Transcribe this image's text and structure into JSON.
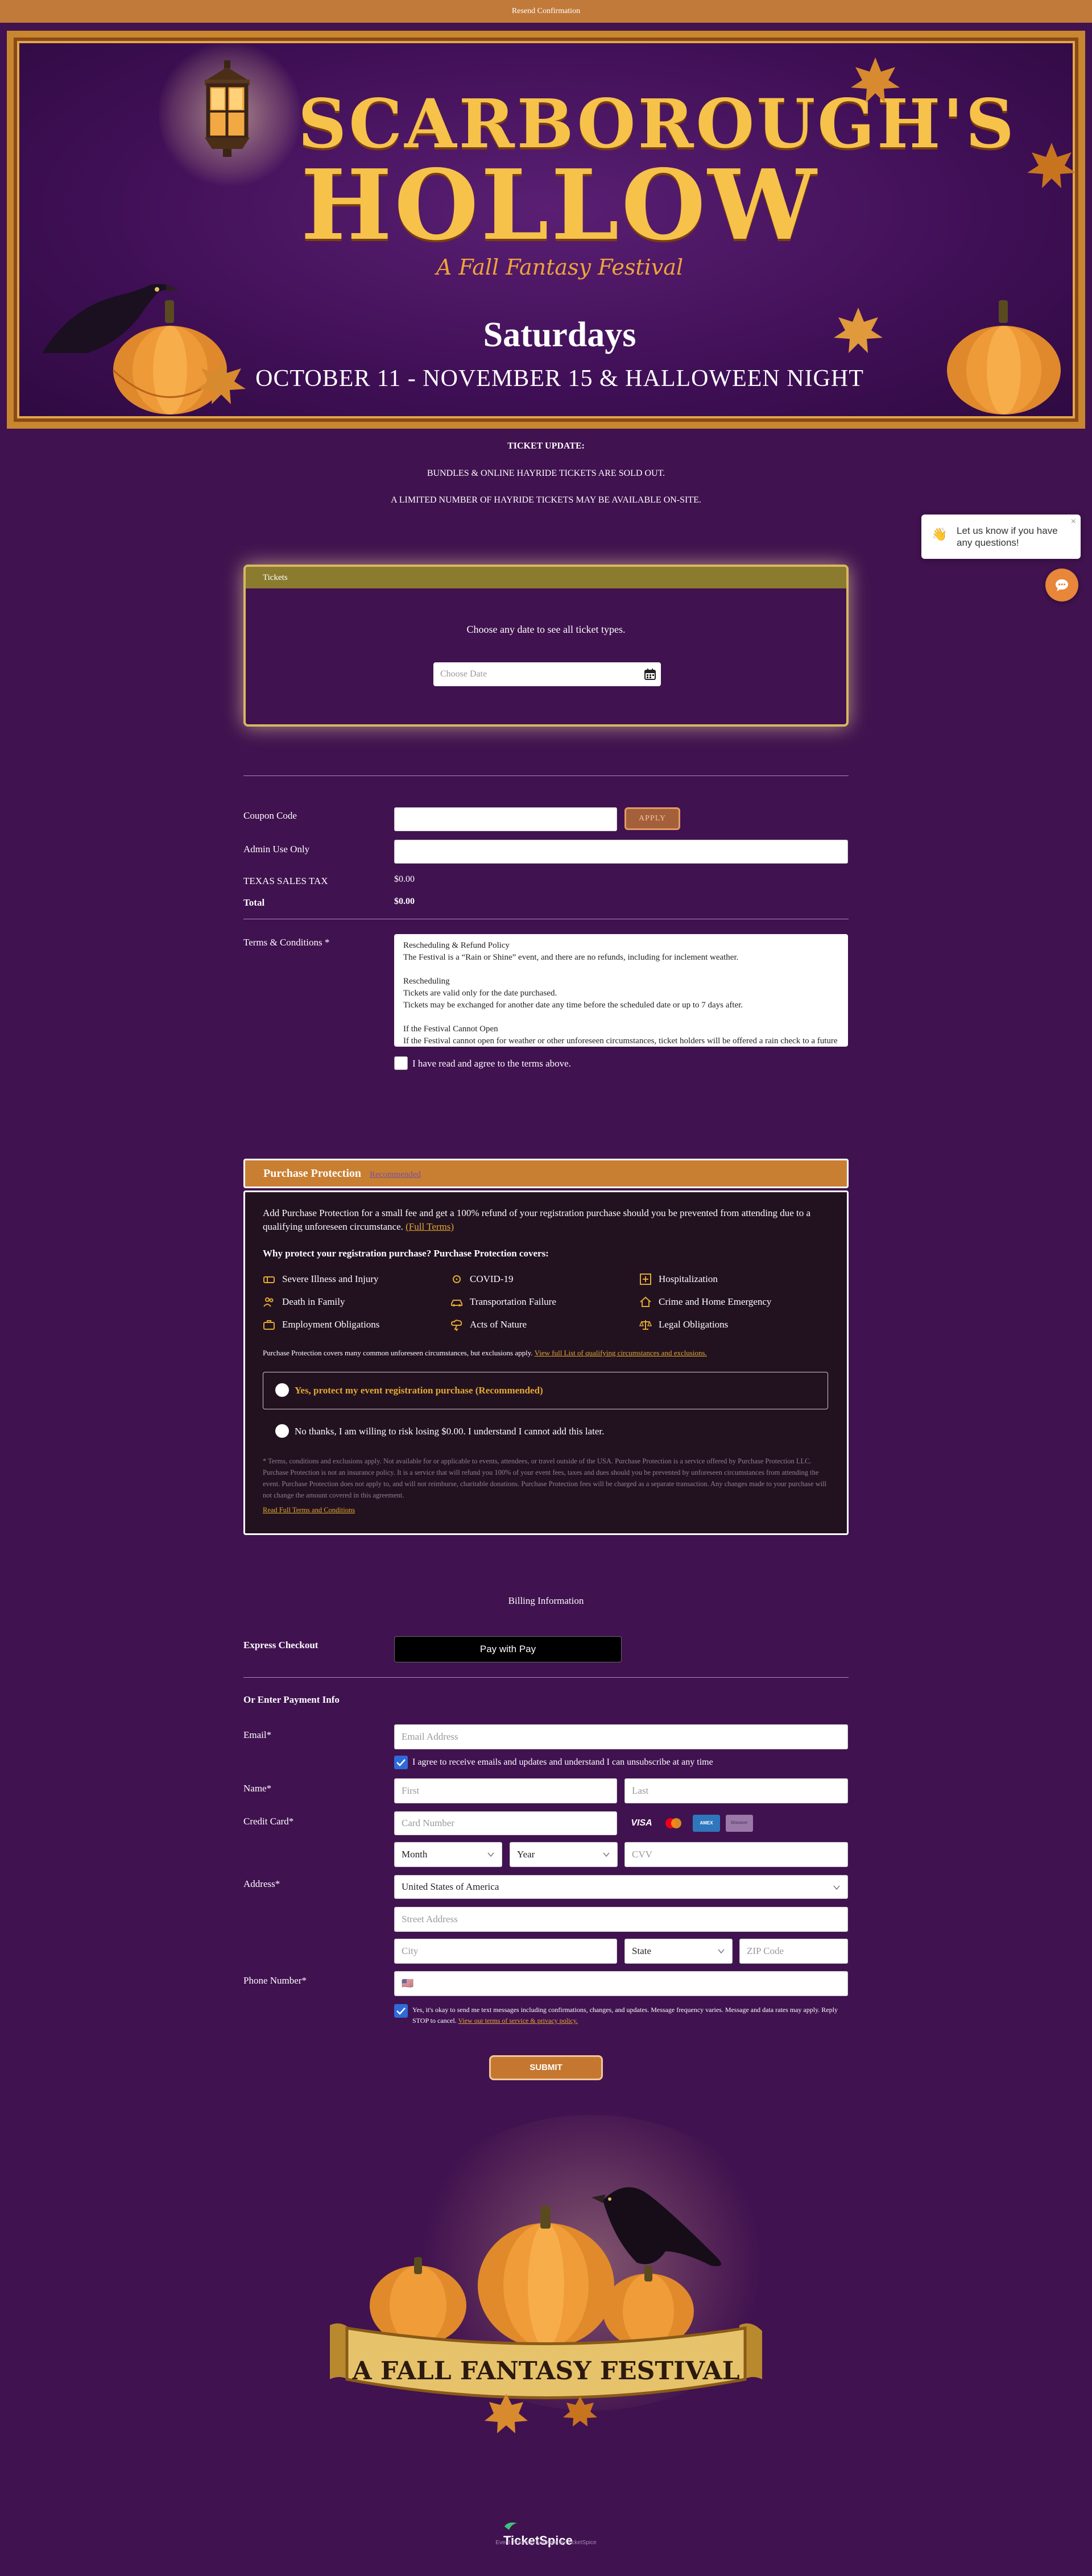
{
  "topbar": {
    "label": "Resend Confirmation"
  },
  "banner": {
    "title_line1": "SCARBOROUGH'S",
    "title_line2": "HOLLOW",
    "subtitle": "A Fall Fantasy Festival",
    "days": "Saturdays",
    "dates": "OCTOBER 11 - NOVEMBER 15 & HALLOWEEN NIGHT"
  },
  "notice": {
    "heading": "TICKET UPDATE:",
    "line1": "BUNDLES & ONLINE HAYRIDE TICKETS ARE SOLD OUT.",
    "line2": "A LIMITED NUMBER OF HAYRIDE TICKETS MAY BE AVAILABLE ON-SITE."
  },
  "chat": {
    "emoji": "👋",
    "message": "Let us know if you have any questions!",
    "close": "×"
  },
  "tickets": {
    "header": "Tickets",
    "prompt": "Choose any date to see all ticket types.",
    "date_placeholder": "Choose Date"
  },
  "order": {
    "coupon_label": "Coupon Code",
    "apply_label": "APPLY",
    "admin_label": "Admin Use Only",
    "tax_label": "TEXAS SALES TAX",
    "tax_value": "$0.00",
    "total_label": "Total",
    "total_value": "$0.00"
  },
  "terms": {
    "label": "Terms & Conditions",
    "required": "*",
    "p1_title": "Rescheduling & Refund Policy",
    "p1_text": "The Festival is a “Rain or Shine” event, and there are no refunds, including for inclement weather.",
    "p2_title": "Rescheduling",
    "p2_line1": "Tickets are valid only for the date purchased.",
    "p2_line2": "Tickets may be exchanged for another date any time before the scheduled date or up to 7 days after.",
    "p3_title": "If the Festival Cannot Open",
    "p3_text": "If the Festival cannot open for weather or other unforeseen circumstances, ticket holders will be offered a rain check to a future date.",
    "agree": "I have read and agree to the terms above."
  },
  "protection": {
    "title": "Purchase Protection",
    "recommended": "Recommended",
    "intro": "Add Purchase Protection for a small fee and get a 100% refund of your registration purchase should you be prevented from attending due to a qualifying unforeseen circumstance.",
    "full_terms": "(Full Terms)",
    "why": "Why protect your registration purchase? Purchase Protection covers:",
    "items": [
      "Severe Illness and Injury",
      "COVID-19",
      "Hospitalization",
      "Death in Family",
      "Transportation Failure",
      "Crime and Home Emergency",
      "Employment Obligations",
      "Acts of Nature",
      "Legal Obligations"
    ],
    "covers": "Purchase Protection covers many common unforeseen circumstances, but exclusions apply.",
    "covers_link": "View full List of qualifying circumstances and exclusions.",
    "yes_option": "Yes, protect my event registration purchase (Recommended)",
    "no_option": "No thanks, I am willing to risk losing $0.00. I understand I cannot add this later.",
    "fine_print": "* Terms, conditions and exclusions apply. Not available for or applicable to events, attendees, or travel outside of the USA. Purchase Protection is a service offered by Purchase Protection LLC. Purchase Protection is not an insurance policy. It is a service that will refund you 100% of your event fees, taxes and dues should you be prevented by unforeseen circumstances from attending the event. Purchase Protection does not apply to, and will not reimburse, charitable donations. Purchase Protection fees will be charged as a separate transaction. Any changes made to your purchase will not change the amount covered in this agreement.",
    "fine_link": "Read Full Terms and Conditions"
  },
  "billing": {
    "heading": "Billing Information",
    "express_label": "Express Checkout",
    "applepay_label": "Pay with  Pay",
    "or_label": "Or Enter Payment Info",
    "email_label": "Email",
    "email_placeholder": "Email Address",
    "email_optin": "I agree to receive emails and updates and understand I can unsubscribe at any time",
    "name_label": "Name",
    "first_placeholder": "First",
    "last_placeholder": "Last",
    "card_label": "Credit Card",
    "card_placeholder": "Card Number",
    "month": "Month",
    "year": "Year",
    "cvv_placeholder": "CVV",
    "card_brands": [
      "VISA",
      "Mastercard",
      "AMEX",
      "Discover"
    ],
    "address_label": "Address",
    "country": "United States of America",
    "street_placeholder": "Street Address",
    "city_placeholder": "City",
    "state": "State",
    "zip_placeholder": "ZIP Code",
    "phone_label": "Phone Number",
    "phone_flag": "🇺🇸",
    "sms_optin": "Yes, it's okay to send me text messages including confirmations, changes, and updates. Message frequency varies. Message and data rates may apply. Reply STOP to cancel.",
    "sms_link": "View our terms of service & privacy policy.",
    "submit": "SUBMIT",
    "required": "*"
  },
  "footer": {
    "banner_text": "A FALL FANTASY FESTIVAL",
    "brand": "TicketSpice",
    "brand_sub": "Event Ticketing Software by TicketSpice"
  },
  "colors": {
    "background": "#40124f",
    "accent_orange": "#c17a3a",
    "gold": "#f6c24a",
    "tickets_header": "#8b7b2f"
  }
}
